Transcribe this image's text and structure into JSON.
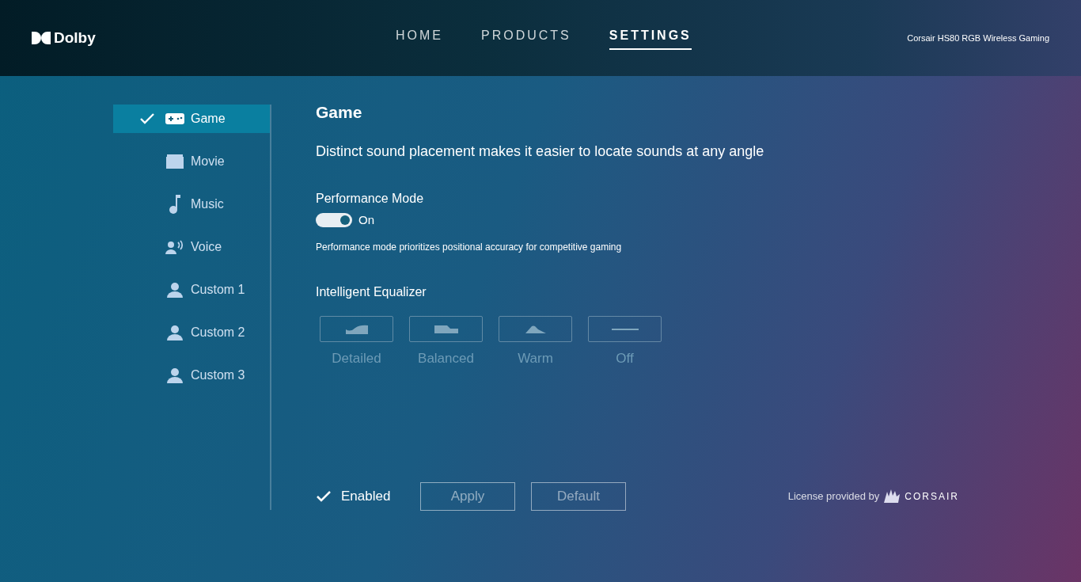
{
  "header": {
    "logo": "Dolby",
    "nav": [
      {
        "label": "HOME",
        "selected": false
      },
      {
        "label": "PRODUCTS",
        "selected": false
      },
      {
        "label": "SETTINGS",
        "selected": true
      }
    ],
    "device": "Corsair HS80 RGB Wireless Gaming"
  },
  "sidebar": {
    "items": [
      {
        "label": "Game",
        "kind": "game",
        "selected": true
      },
      {
        "label": "Movie",
        "kind": "movie",
        "selected": false
      },
      {
        "label": "Music",
        "kind": "music",
        "selected": false
      },
      {
        "label": "Voice",
        "kind": "voice",
        "selected": false
      },
      {
        "label": "Custom 1",
        "kind": "custom",
        "selected": false
      },
      {
        "label": "Custom 2",
        "kind": "custom",
        "selected": false
      },
      {
        "label": "Custom 3",
        "kind": "custom",
        "selected": false
      }
    ]
  },
  "content": {
    "title": "Game",
    "description": "Distinct sound placement makes it easier to locate sounds at any angle",
    "performance_mode": {
      "label": "Performance Mode",
      "on": true,
      "state_label": "On",
      "hint": "Performance mode prioritizes positional accuracy for competitive gaming"
    },
    "equalizer": {
      "label": "Intelligent Equalizer",
      "presets": [
        {
          "label": "Detailed",
          "kind": "detailed",
          "disabled": true
        },
        {
          "label": "Balanced",
          "kind": "balanced",
          "disabled": true
        },
        {
          "label": "Warm",
          "kind": "warm",
          "disabled": true
        },
        {
          "label": "Off",
          "kind": "off",
          "disabled": true
        }
      ]
    }
  },
  "footer": {
    "enabled": {
      "label": "Enabled",
      "checked": true
    },
    "buttons": [
      {
        "label": "Apply",
        "disabled": true
      },
      {
        "label": "Default",
        "disabled": true
      }
    ],
    "license": "License provided by",
    "brand": "CORSAIR"
  }
}
